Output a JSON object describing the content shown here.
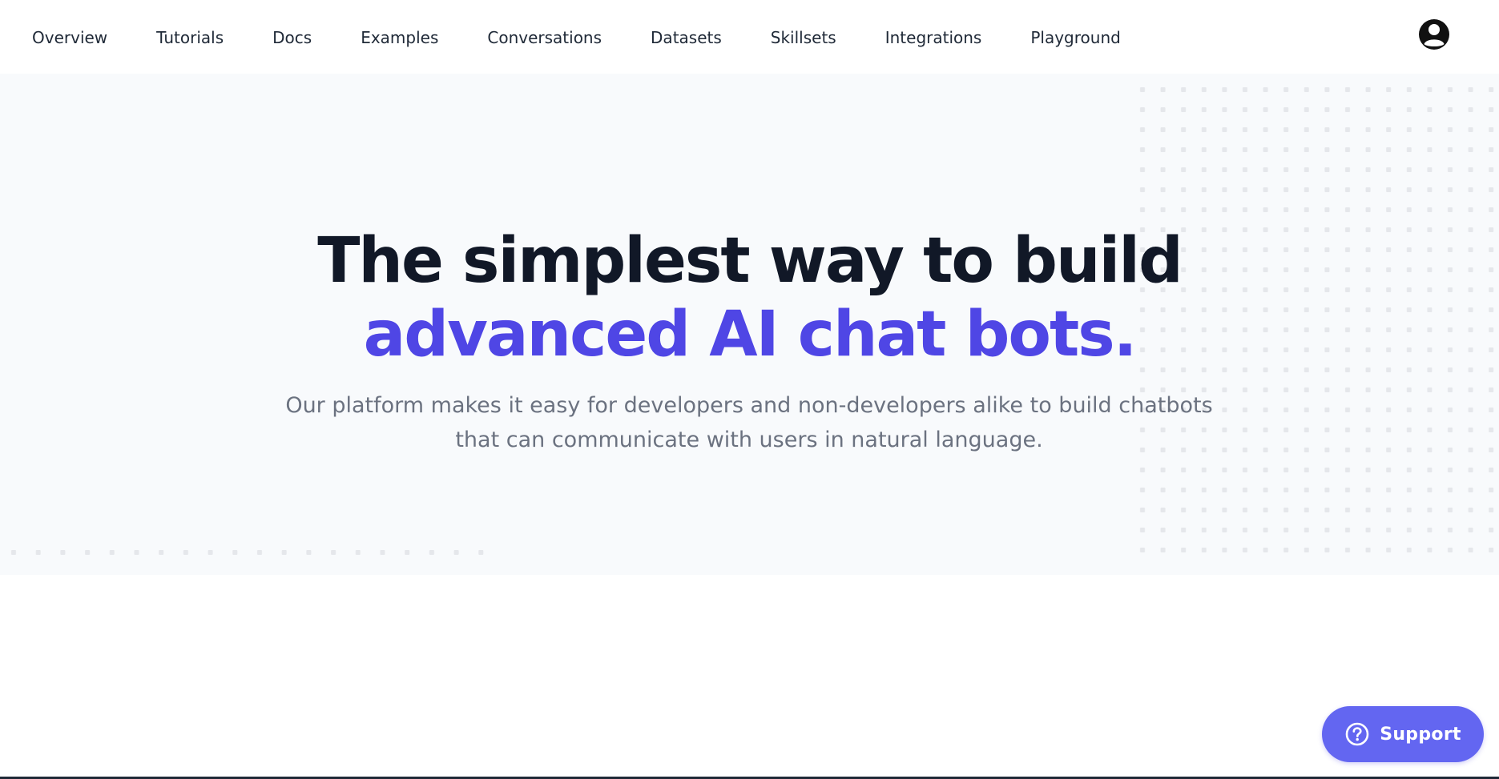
{
  "nav": {
    "items": [
      {
        "label": "Overview"
      },
      {
        "label": "Tutorials"
      },
      {
        "label": "Docs"
      },
      {
        "label": "Examples"
      },
      {
        "label": "Conversations"
      },
      {
        "label": "Datasets"
      },
      {
        "label": "Skillsets"
      },
      {
        "label": "Integrations"
      },
      {
        "label": "Playground"
      }
    ],
    "avatar_icon": "user-circle-icon"
  },
  "hero": {
    "title_line1": "The simplest way to build",
    "title_line2": "advanced AI chat bots.",
    "subtitle_line1": "Our platform makes it easy for developers and non-developers alike to build chatbots",
    "subtitle_line2": "that can communicate with users in natural language."
  },
  "support": {
    "label": "Support",
    "icon": "question-circle-icon"
  },
  "colors": {
    "accent": "#4f46e5",
    "support_bg": "#6366f1",
    "hero_bg": "#f8fafc",
    "heading": "#111827",
    "body_text": "#6b7280"
  }
}
